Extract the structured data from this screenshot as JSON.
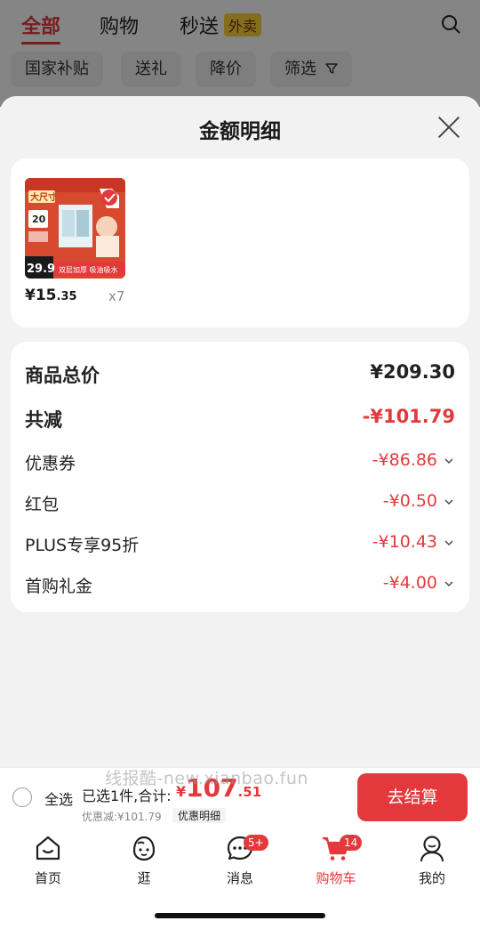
{
  "top_tabs": [
    {
      "label": "全部",
      "active": true
    },
    {
      "label": "购物",
      "active": false
    },
    {
      "label": "秒送",
      "active": false,
      "tag": "外卖"
    }
  ],
  "chips": [
    "国家补贴",
    "送礼",
    "降价",
    "筛选"
  ],
  "sheet": {
    "title": "金额明细",
    "product": {
      "image_texts": {
        "badge": "大尺寸",
        "day": "20",
        "price_tag": "29.9",
        "slogan": "双层加厚 吸油吸水"
      },
      "price_int": "¥15",
      "price_dec": ".35",
      "qty": "x7"
    },
    "rows": [
      {
        "label": "商品总价",
        "value": "¥209.30",
        "style": "big"
      },
      {
        "label": "共减",
        "value": "-¥101.79",
        "style": "big-red"
      },
      {
        "label": "优惠券",
        "value": "-¥86.86",
        "style": "red-chev"
      },
      {
        "label": "红包",
        "value": "-¥0.50",
        "style": "red-chev"
      },
      {
        "label": "PLUS专享95折",
        "value": "-¥10.43",
        "style": "red-chev"
      },
      {
        "label": "首购礼金",
        "value": "-¥4.00",
        "style": "red-chev"
      }
    ]
  },
  "checkout": {
    "select_all": "全选",
    "summary": "已选1件,合计:",
    "total_yen": "¥",
    "total_int": "107",
    "total_dec": ".51",
    "discount_line": "优惠减:¥101.79",
    "detail_link": "优惠明细",
    "button": "去结算",
    "watermark": "线报酷-new.xianbao.fun"
  },
  "tabbar": [
    {
      "label": "首页",
      "icon": "home-icon"
    },
    {
      "label": "逛",
      "icon": "face-icon"
    },
    {
      "label": "消息",
      "icon": "message-icon",
      "badge": "5+"
    },
    {
      "label": "购物车",
      "icon": "cart-icon",
      "badge": "14",
      "active": true
    },
    {
      "label": "我的",
      "icon": "user-icon"
    }
  ],
  "colors": {
    "accent": "#e4393c",
    "tag_yellow": "#ffd23f"
  }
}
